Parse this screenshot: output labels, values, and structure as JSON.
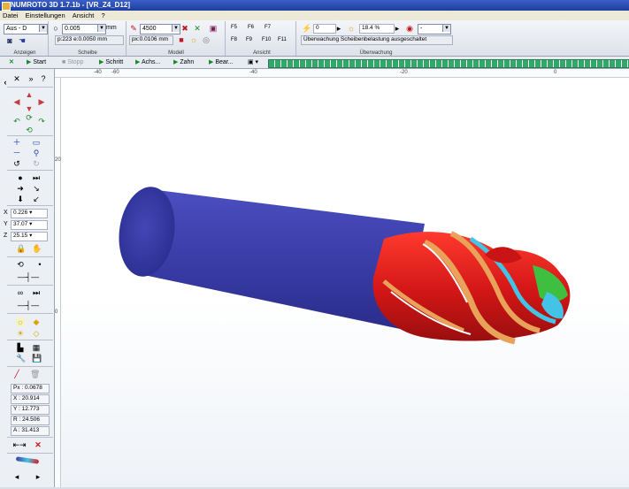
{
  "window": {
    "title": "NUMROTO 3D 1.7.1b - [VR_Z4_D12]"
  },
  "menu": [
    "Datei",
    "Einstellungen",
    "Ansicht",
    "?"
  ],
  "ribbon": {
    "anzeigen": {
      "label": "Anzeigen",
      "mode": "Aus - D"
    },
    "scheibe": {
      "label": "Scheibe",
      "step": "0.005",
      "unit": "mm",
      "info": "p:223 e:0.0050 mm"
    },
    "modell": {
      "label": "Modell",
      "resolution": "4500",
      "px_value": "px:0.0106 mm"
    },
    "ansicht": {
      "label": "Ansicht",
      "keys": [
        "F5",
        "F6",
        "F7",
        "F8",
        "F9",
        "F10",
        "F11"
      ]
    },
    "ueberwachung": {
      "label": "Überwachung",
      "counter": "0",
      "percent": "18.4 %",
      "dash": "-",
      "status": "Überwachung Scheibenbelastung ausgeschaltet"
    }
  },
  "runbar": {
    "start": "Start",
    "stop": "Stopp",
    "schritt": "Schritt",
    "achse": "Achs...",
    "zahn": "Zahn",
    "bear": "Bear...",
    "f_keys": [
      "F5",
      "F6",
      "F7",
      "F8"
    ]
  },
  "coords": {
    "x": "0.226",
    "y": "37.07",
    "z": "25.15"
  },
  "readout": {
    "px": "Px : 0.0678",
    "x": "X : 20.914",
    "y": "Y : 12.773",
    "r": "R : 24.506",
    "a": "A : 31.413"
  },
  "ruler": {
    "top": [
      "-40",
      "-60",
      "-40",
      "-20",
      "0"
    ],
    "left": [
      "20",
      "0"
    ]
  },
  "colors": {
    "shank": "#3b3ea6",
    "tool_red": "#d81c1c",
    "accent_orange": "#e8a25a",
    "accent_cyan": "#43c3e5",
    "accent_green": "#3fbf3f",
    "progress": "#32a86a"
  },
  "icons": [
    "close-icon",
    "start-icon",
    "stop-icon",
    "step-icon",
    "axis-icon",
    "tooth-icon",
    "arrow-icons",
    "zoom-icon",
    "rotate-icon",
    "lock-icon",
    "hand-icon",
    "save-icon"
  ]
}
